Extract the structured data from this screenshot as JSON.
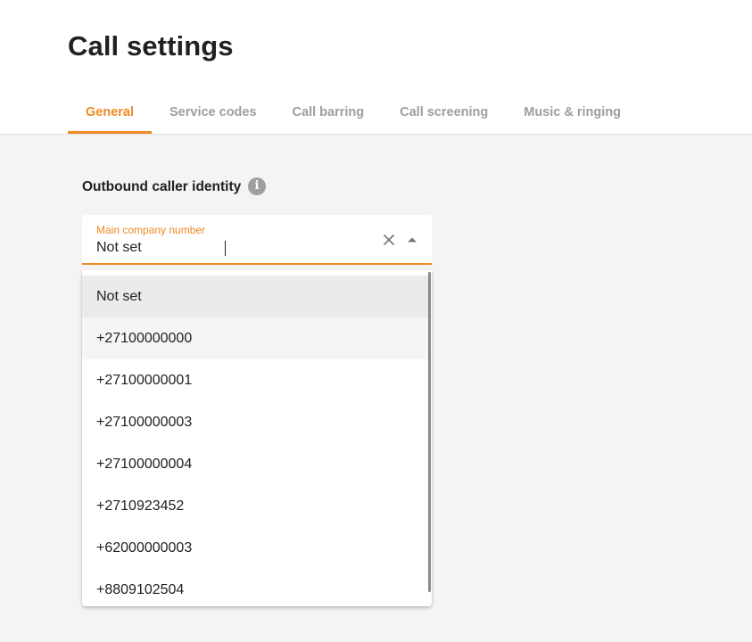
{
  "page": {
    "title": "Call settings"
  },
  "tabs": [
    {
      "label": "General",
      "active": true
    },
    {
      "label": "Service codes",
      "active": false
    },
    {
      "label": "Call barring",
      "active": false
    },
    {
      "label": "Call screening",
      "active": false
    },
    {
      "label": "Music & ringing",
      "active": false
    }
  ],
  "section": {
    "label": "Outbound caller identity",
    "info_icon": "i"
  },
  "select": {
    "label": "Main company number",
    "value": "Not set"
  },
  "options": [
    {
      "label": "Not set",
      "state": "selected"
    },
    {
      "label": "+27100000000",
      "state": "hovered"
    },
    {
      "label": "+27100000001",
      "state": "normal"
    },
    {
      "label": "+27100000003",
      "state": "normal"
    },
    {
      "label": "+27100000004",
      "state": "normal"
    },
    {
      "label": "+2710923452",
      "state": "normal"
    },
    {
      "label": "+62000000003",
      "state": "normal"
    },
    {
      "label": "+8809102504",
      "state": "normal"
    }
  ],
  "colors": {
    "accent": "#f08a24",
    "background": "#f4f4f4",
    "inactive_tab": "#9e9e9e"
  }
}
